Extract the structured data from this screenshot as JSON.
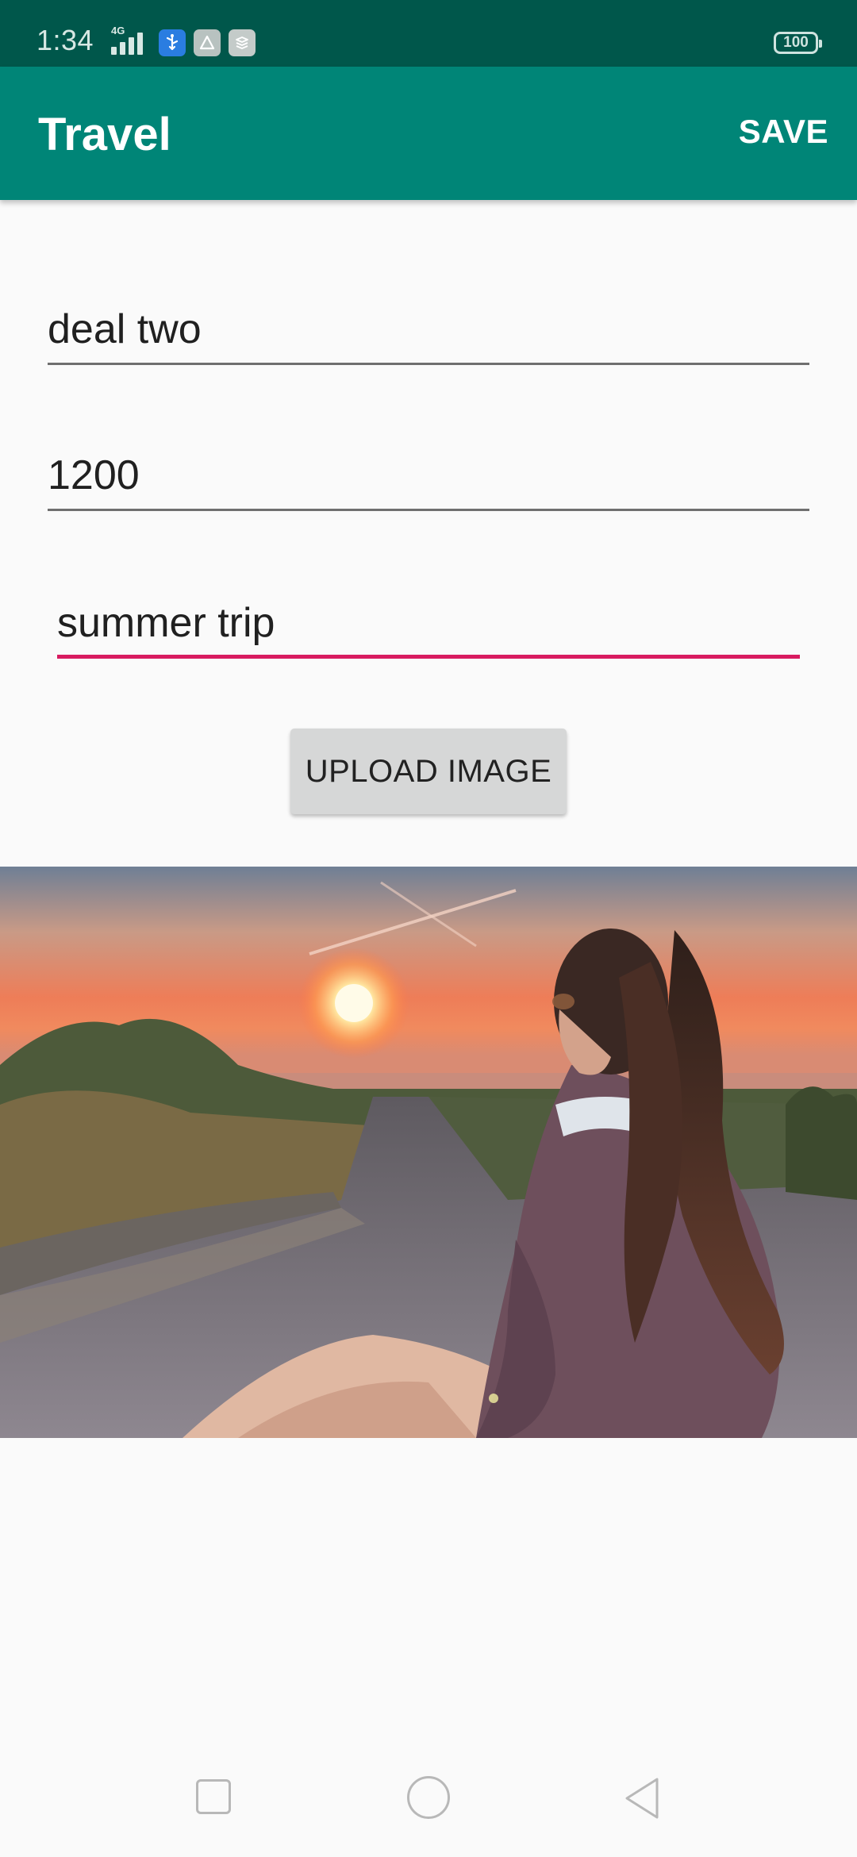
{
  "status_bar": {
    "time": "1:34",
    "network_label": "4G",
    "battery": "100"
  },
  "app_bar": {
    "title": "Travel",
    "save_label": "SAVE"
  },
  "form": {
    "name_value": "deal two",
    "price_value": "1200",
    "description_value": "summer trip",
    "upload_label": "UPLOAD IMAGE"
  },
  "colors": {
    "status_bar": "#00574b",
    "app_bar": "#008577",
    "accent": "#d81b60",
    "background": "#fafafa"
  },
  "icons": {
    "signal": "signal-icon",
    "usb": "usb-icon",
    "battery": "battery-icon",
    "recent": "recent-apps-icon",
    "home": "home-icon",
    "back": "back-icon"
  }
}
